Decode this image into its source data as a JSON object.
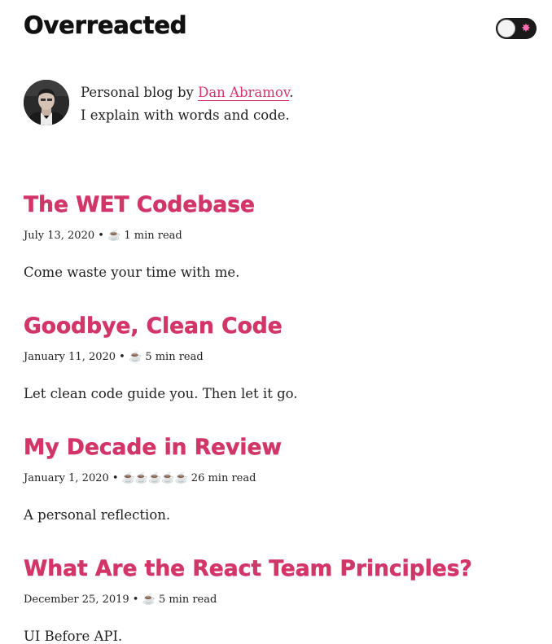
{
  "header": {
    "site_title": "Overreacted",
    "theme_toggle_icon": "sun-icon",
    "theme_toggle_glyph": "✸"
  },
  "bio": {
    "prefix": "Personal blog by ",
    "author_link": "Dan Abramov",
    "suffix": ".",
    "tagline": "I explain with words and code."
  },
  "colors": {
    "accent": "#d23669",
    "text": "#222222",
    "title": "#111111",
    "toggle_bg": "#1a1a1a"
  },
  "posts": [
    {
      "title": "The WET Codebase",
      "date": "July 13, 2020",
      "reading_icons": "☕",
      "reading_time": "1 min read",
      "spoiler": "Come waste your time with me."
    },
    {
      "title": "Goodbye, Clean Code",
      "date": "January 11, 2020",
      "reading_icons": "☕",
      "reading_time": "5 min read",
      "spoiler": "Let clean code guide you. Then let it go."
    },
    {
      "title": "My Decade in Review",
      "date": "January 1, 2020",
      "reading_icons": "☕☕☕☕☕",
      "reading_time": "26 min read",
      "spoiler": "A personal reflection."
    },
    {
      "title": "What Are the React Team Principles?",
      "date": "December 25, 2019",
      "reading_icons": "☕",
      "reading_time": "5 min read",
      "spoiler": "UI Before API."
    }
  ]
}
